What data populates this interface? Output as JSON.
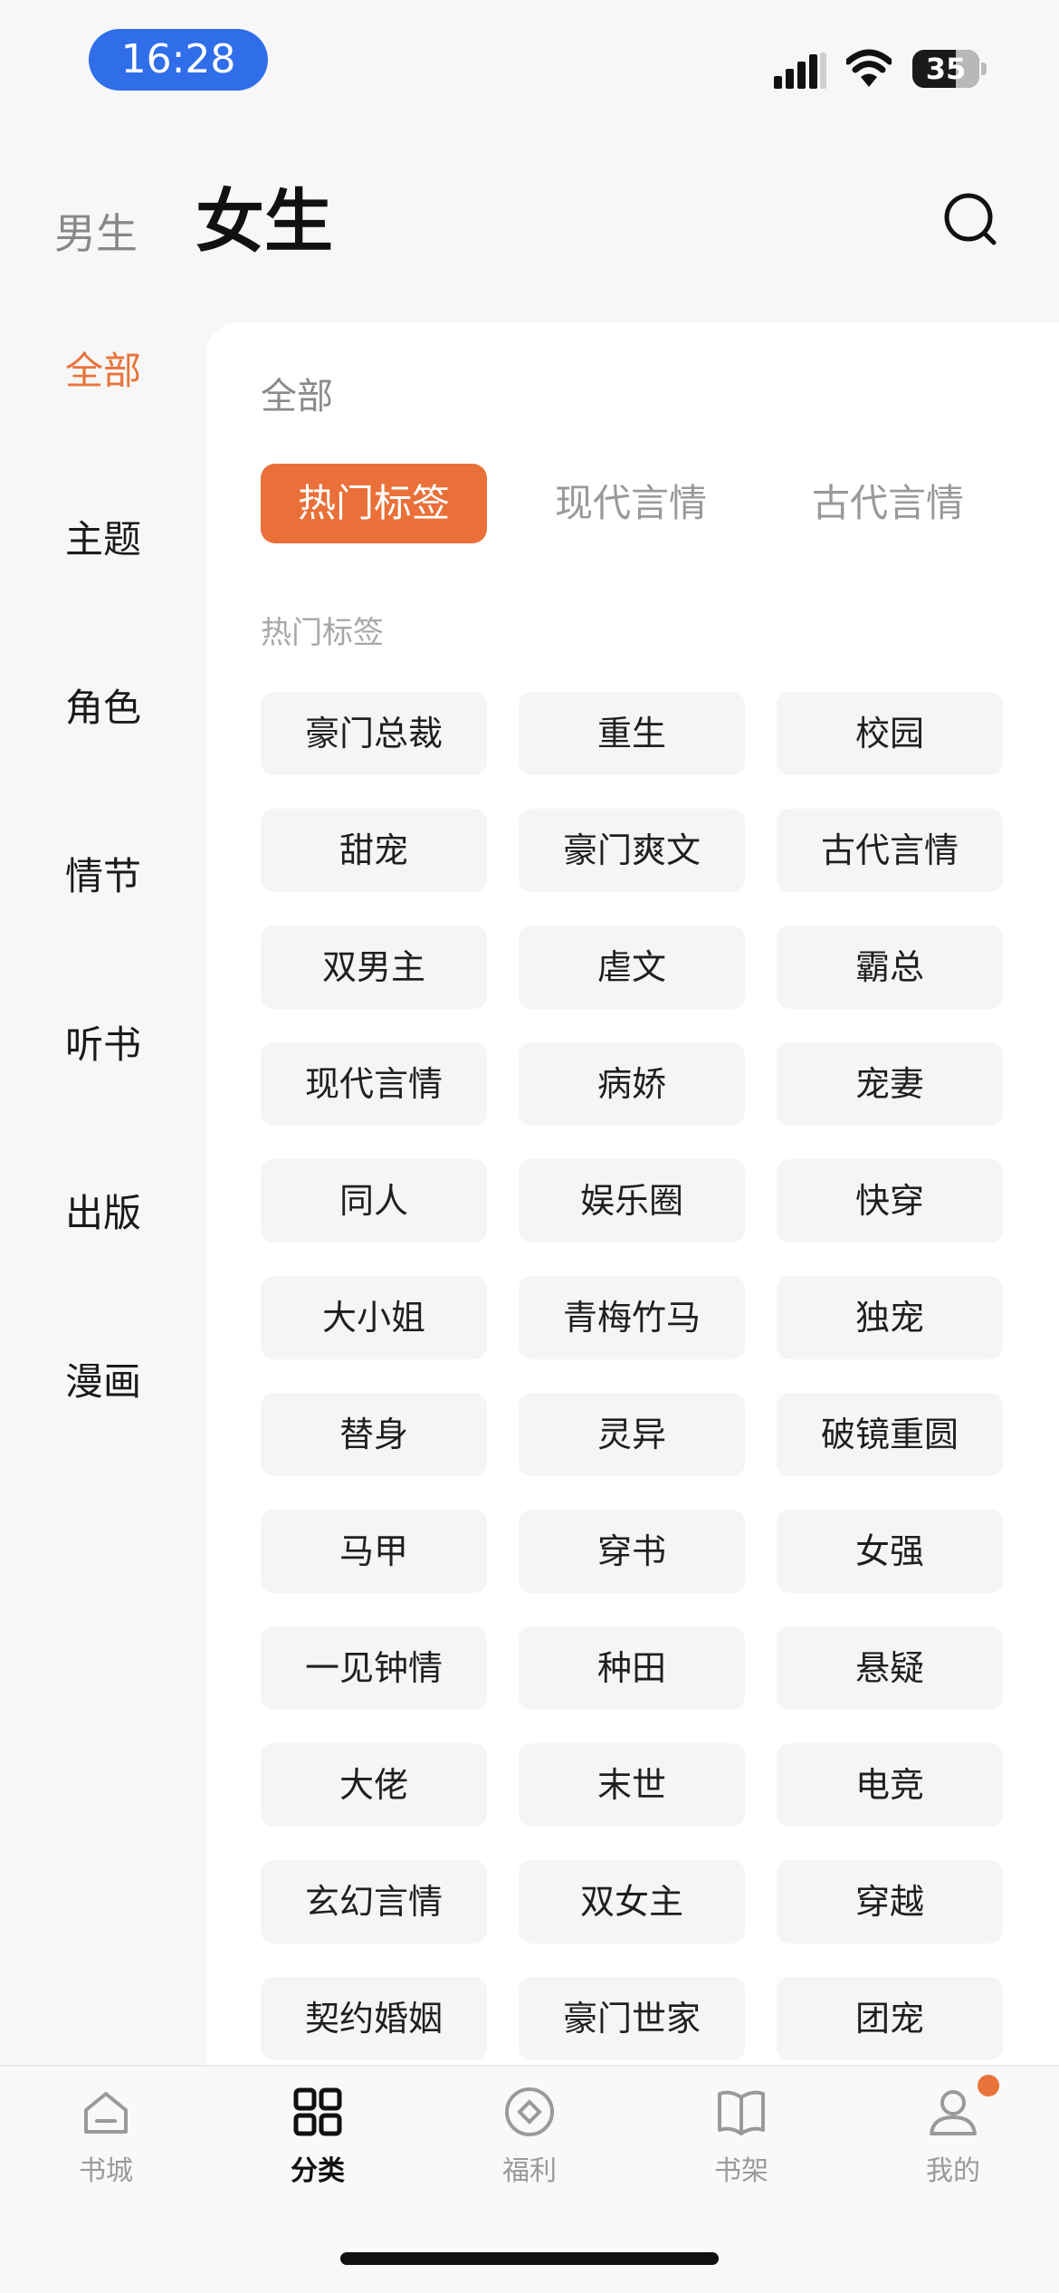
{
  "status_bar": {
    "time": "16:28",
    "battery": "35",
    "battery_level": 0.35
  },
  "header": {
    "tab_male": "男生",
    "tab_female": "女生"
  },
  "sidebar": {
    "items": [
      {
        "label": "全部"
      },
      {
        "label": "主题"
      },
      {
        "label": "角色"
      },
      {
        "label": "情节"
      },
      {
        "label": "听书"
      },
      {
        "label": "出版"
      },
      {
        "label": "漫画"
      }
    ],
    "active_index": 0
  },
  "panel": {
    "section_title": "全部",
    "sub_tabs": [
      {
        "label": "热门标签"
      },
      {
        "label": "现代言情"
      },
      {
        "label": "古代言情"
      }
    ],
    "active_sub_tab": 0,
    "tags_title": "热门标签",
    "tags": [
      "豪门总裁",
      "重生",
      "校园",
      "甜宠",
      "豪门爽文",
      "古代言情",
      "双男主",
      "虐文",
      "霸总",
      "现代言情",
      "病娇",
      "宠妻",
      "同人",
      "娱乐圈",
      "快穿",
      "大小姐",
      "青梅竹马",
      "独宠",
      "替身",
      "灵异",
      "破镜重圆",
      "马甲",
      "穿书",
      "女强",
      "一见钟情",
      "种田",
      "悬疑",
      "大佬",
      "末世",
      "电竞",
      "玄幻言情",
      "双女主",
      "穿越",
      "契约婚姻",
      "豪门世家",
      "团宠"
    ]
  },
  "bottom_nav": {
    "items": [
      {
        "label": "书城",
        "icon": "home-icon"
      },
      {
        "label": "分类",
        "icon": "grid-icon"
      },
      {
        "label": "福利",
        "icon": "coin-icon"
      },
      {
        "label": "书架",
        "icon": "book-icon"
      },
      {
        "label": "我的",
        "icon": "user-icon"
      }
    ],
    "active_index": 1
  },
  "colors": {
    "accent": "#e8743b",
    "time_pill": "#2f6ee8"
  }
}
